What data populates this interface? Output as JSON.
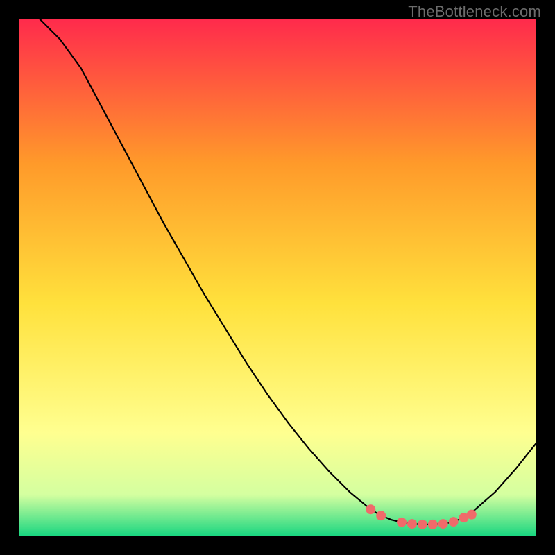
{
  "watermark": "TheBottleneck.com",
  "chart_data": {
    "type": "line",
    "title": "",
    "xlabel": "",
    "ylabel": "",
    "xlim": [
      0,
      100
    ],
    "ylim": [
      0,
      100
    ],
    "grid": false,
    "legend": false,
    "background_gradient": {
      "top": "#ff2a4c",
      "mid1": "#ff9a2a",
      "mid2": "#ffe13c",
      "mid3": "#ffff90",
      "low": "#d4ffa0",
      "bottom": "#17d680"
    },
    "series": [
      {
        "name": "bottleneck-curve",
        "color": "#000000",
        "width": 2.2,
        "x": [
          4,
          8,
          12,
          16,
          20,
          24,
          28,
          32,
          36,
          40,
          44,
          48,
          52,
          56,
          60,
          64,
          68,
          70,
          72,
          74,
          76,
          78,
          80,
          82,
          84,
          86,
          88,
          92,
          96,
          100
        ],
        "y": [
          100,
          96,
          90.5,
          83,
          75.5,
          68,
          60.5,
          53.5,
          46.5,
          40,
          33.5,
          27.5,
          22,
          17,
          12.5,
          8.5,
          5.2,
          4.0,
          3.2,
          2.7,
          2.4,
          2.3,
          2.3,
          2.4,
          2.8,
          3.6,
          5.0,
          8.5,
          13,
          18
        ]
      }
    ],
    "markers": {
      "name": "highlight-dots",
      "color": "#f06a6a",
      "radius": 7,
      "x": [
        68,
        70,
        74,
        76,
        78,
        80,
        82,
        84,
        86,
        87.5
      ],
      "y": [
        5.2,
        4.0,
        2.7,
        2.4,
        2.3,
        2.3,
        2.4,
        2.8,
        3.6,
        4.2
      ]
    }
  }
}
